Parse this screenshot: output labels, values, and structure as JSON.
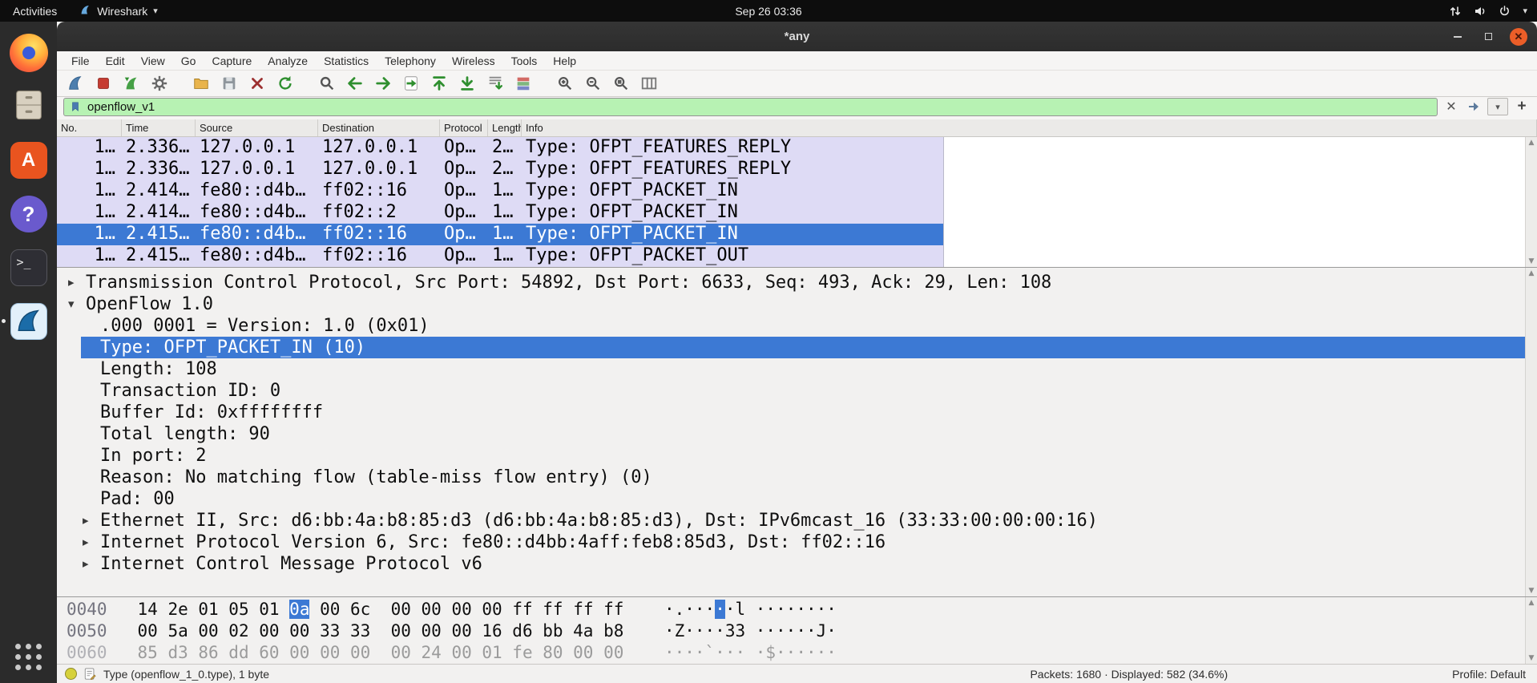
{
  "colors": {
    "selection_blue": "#3c79d4",
    "filter_green": "#b7f2b3",
    "row_lavender": "#dedbf5",
    "close_button_orange": "#eb5e28",
    "wireshark_fin_blue": "#1b6ca8"
  },
  "topbar": {
    "activities": "Activities",
    "app_menu": "Wireshark",
    "clock": "Sep 26 03:36"
  },
  "dock": {
    "items": [
      "firefox",
      "files",
      "ubuntu-software",
      "help",
      "terminal",
      "wireshark"
    ],
    "apps_grid": "show-applications"
  },
  "titlebar": {
    "title": "*any"
  },
  "menubar": {
    "items": [
      "File",
      "Edit",
      "View",
      "Go",
      "Capture",
      "Analyze",
      "Statistics",
      "Telephony",
      "Wireless",
      "Tools",
      "Help"
    ]
  },
  "toolbar": {
    "icons": [
      "start-capture",
      "stop-capture",
      "restart-capture",
      "capture-options",
      "open-file",
      "save-file",
      "close-file",
      "reload",
      "find-packet",
      "go-back",
      "go-forward",
      "go-to-packet",
      "go-first",
      "go-last",
      "auto-scroll",
      "colorize",
      "zoom-in",
      "zoom-out",
      "zoom-original",
      "resize-columns"
    ]
  },
  "filter": {
    "value": "openflow_v1"
  },
  "packet_list": {
    "columns": [
      "No.",
      "Time",
      "Source",
      "Destination",
      "Protocol",
      "Length",
      "Info"
    ],
    "rows": [
      {
        "no": "1…",
        "time": "2.336…",
        "source": "127.0.0.1",
        "destination": "127.0.0.1",
        "protocol": "Op…",
        "length": "2…",
        "info": "Type: OFPT_FEATURES_REPLY",
        "selected": false
      },
      {
        "no": "1…",
        "time": "2.336…",
        "source": "127.0.0.1",
        "destination": "127.0.0.1",
        "protocol": "Op…",
        "length": "2…",
        "info": "Type: OFPT_FEATURES_REPLY",
        "selected": false
      },
      {
        "no": "1…",
        "time": "2.414…",
        "source": "fe80::d4b…",
        "destination": "ff02::16",
        "protocol": "Op…",
        "length": "1…",
        "info": "Type: OFPT_PACKET_IN",
        "selected": false
      },
      {
        "no": "1…",
        "time": "2.414…",
        "source": "fe80::d4b…",
        "destination": "ff02::2",
        "protocol": "Op…",
        "length": "1…",
        "info": "Type: OFPT_PACKET_IN",
        "selected": false
      },
      {
        "no": "1…",
        "time": "2.415…",
        "source": "fe80::d4b…",
        "destination": "ff02::16",
        "protocol": "Op…",
        "length": "1…",
        "info": "Type: OFPT_PACKET_IN",
        "selected": true
      },
      {
        "no": "1…",
        "time": "2.415…",
        "source": "fe80::d4b…",
        "destination": "ff02::16",
        "protocol": "Op…",
        "length": "1…",
        "info": "Type: OFPT_PACKET_OUT",
        "selected": false
      }
    ]
  },
  "details": {
    "lines": [
      {
        "indent": 0,
        "expander": "collapsed",
        "selected": false,
        "text": "Transmission Control Protocol, Src Port: 54892, Dst Port: 6633, Seq: 493, Ack: 29, Len: 108"
      },
      {
        "indent": 0,
        "expander": "expanded",
        "selected": false,
        "text": "OpenFlow 1.0"
      },
      {
        "indent": 1,
        "expander": null,
        "selected": false,
        "text": ".000 0001 = Version: 1.0 (0x01)"
      },
      {
        "indent": 1,
        "expander": null,
        "selected": true,
        "text": "Type: OFPT_PACKET_IN (10)"
      },
      {
        "indent": 1,
        "expander": null,
        "selected": false,
        "text": "Length: 108"
      },
      {
        "indent": 1,
        "expander": null,
        "selected": false,
        "text": "Transaction ID: 0"
      },
      {
        "indent": 1,
        "expander": null,
        "selected": false,
        "text": "Buffer Id: 0xffffffff"
      },
      {
        "indent": 1,
        "expander": null,
        "selected": false,
        "text": "Total length: 90"
      },
      {
        "indent": 1,
        "expander": null,
        "selected": false,
        "text": "In port: 2"
      },
      {
        "indent": 1,
        "expander": null,
        "selected": false,
        "text": "Reason: No matching flow (table-miss flow entry) (0)"
      },
      {
        "indent": 1,
        "expander": null,
        "selected": false,
        "text": "Pad: 00"
      },
      {
        "indent": 1,
        "expander": "collapsed",
        "selected": false,
        "text": "Ethernet II, Src: d6:bb:4a:b8:85:d3 (d6:bb:4a:b8:85:d3), Dst: IPv6mcast_16 (33:33:00:00:00:16)"
      },
      {
        "indent": 1,
        "expander": "collapsed",
        "selected": false,
        "text": "Internet Protocol Version 6, Src: fe80::d4bb:4aff:feb8:85d3, Dst: ff02::16"
      },
      {
        "indent": 1,
        "expander": "collapsed",
        "selected": false,
        "text": "Internet Control Message Protocol v6"
      }
    ]
  },
  "hex": {
    "rows": [
      {
        "offset": "0040",
        "dim": false,
        "hex": [
          {
            "t": "14 2e 01 05 01 ",
            "hl": false
          },
          {
            "t": "0a",
            "hl": true
          },
          {
            "t": " 00 6c  00 00 00 00 ff ff ff ff",
            "hl": false
          }
        ],
        "ascii": [
          {
            "t": "·.···",
            "hl": false
          },
          {
            "t": "·",
            "hl": true
          },
          {
            "t": "·l ········",
            "hl": false
          }
        ]
      },
      {
        "offset": "0050",
        "dim": false,
        "hex": [
          {
            "t": "00 5a 00 02 00 00 33 33  00 00 00 16 d6 bb 4a b8",
            "hl": false
          }
        ],
        "ascii": [
          {
            "t": "·Z····33 ······J·",
            "hl": false
          }
        ]
      },
      {
        "offset": "0060",
        "dim": true,
        "hex": [
          {
            "t": "85 d3 86 dd 60 00 00 00  00 24 00 01 fe 80 00 00",
            "hl": false
          }
        ],
        "ascii": [
          {
            "t": "····`··· ·$······",
            "hl": false
          }
        ]
      }
    ]
  },
  "statusbar": {
    "field_info": "Type (openflow_1_0.type), 1 byte",
    "packets": "Packets: 1680 · Displayed: 582 (34.6%)",
    "profile": "Profile: Default"
  }
}
